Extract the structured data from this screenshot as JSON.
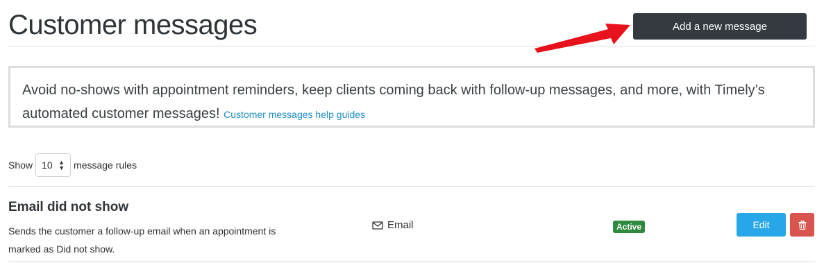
{
  "header": {
    "title": "Customer messages",
    "add_button_label": "Add a new message"
  },
  "info": {
    "text": "Avoid no-shows with appointment reminders, keep clients coming back with follow-up messages, and more, with Timely’s automated customer messages!",
    "link_label": "Customer messages help guides"
  },
  "pagination": {
    "show_label": "Show",
    "page_size": "10",
    "suffix_label": "message rules"
  },
  "rules": [
    {
      "title": "Email did not show",
      "description": "Sends the customer a follow-up email when an appointment is marked as Did not show.",
      "channel": "Email",
      "status": "Active",
      "edit_label": "Edit"
    }
  ],
  "icons": {
    "channel": "envelope-icon",
    "delete": "trash-icon",
    "annotation": "red-arrow"
  },
  "colors": {
    "primary_dark": "#343a40",
    "link": "#1a8dc4",
    "active_badge": "#2f8a3f",
    "edit": "#27a6e8",
    "delete": "#d9534f",
    "arrow": "#e8121c"
  }
}
